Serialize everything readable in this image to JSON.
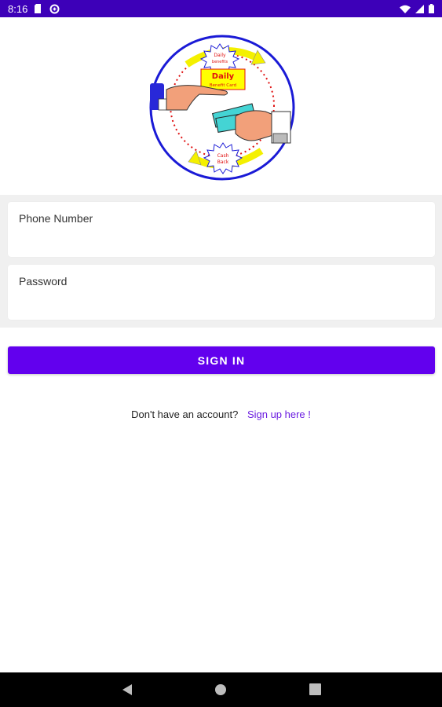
{
  "status_bar": {
    "time": "8:16",
    "icons_left": [
      "sim-card-icon",
      "data-saver-icon"
    ],
    "icons_right": [
      "wifi-icon",
      "signal-icon",
      "battery-icon"
    ],
    "color": "#3d00b8"
  },
  "logo": {
    "title": "Daily",
    "subtitle": "Benefit Card"
  },
  "form": {
    "phone_placeholder": "Phone Number",
    "password_placeholder": "Password"
  },
  "signin": {
    "label": "SIGN IN",
    "color": "#6200ee"
  },
  "signup": {
    "prompt": "Don't have an account?",
    "link": "Sign up here !"
  },
  "nav": {
    "icons": [
      "back-icon",
      "home-icon",
      "recents-icon"
    ]
  }
}
